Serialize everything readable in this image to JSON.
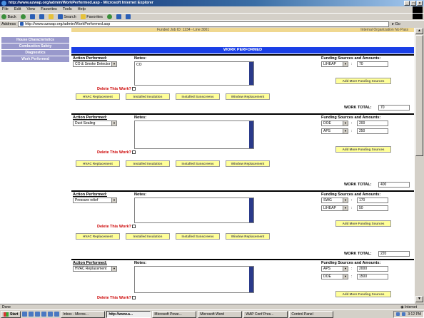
{
  "browser": {
    "title": "http://www.azwap.org/admin/WorkPerformed.asp - Microsoft Internet Explorer",
    "menu": [
      "File",
      "Edit",
      "View",
      "Favorites",
      "Tools",
      "Help"
    ],
    "toolbar": {
      "back": "Back",
      "search": "Search",
      "favorites": "Favorites"
    },
    "address_label": "Address",
    "address": "http://www.azwap.org/admin/WorkPerformed.asp",
    "go": "Go"
  },
  "sidebar": {
    "items": [
      {
        "label": "House Characteristics"
      },
      {
        "label": "Combustion Safety"
      },
      {
        "label": "Diagnostics"
      },
      {
        "label": "Work Performed"
      }
    ]
  },
  "header_strip": {
    "left": "Funded Job ID: 1234 - Line 3001",
    "right": "Internal Organization No Pass"
  },
  "banner": "WORK PERFORMED",
  "labels": {
    "action": "Action Performed:",
    "notes": "Notes:",
    "funding": "Funding Sources and Amounts:",
    "delete": "Delete This Work?",
    "add_funding": "Add More Funding Sources",
    "work_total": "WORK TOTAL:",
    "quick_buttons": [
      "HVAC Replacement",
      "Installed Insulation",
      "Installed Sunscreens",
      "Window Replacement"
    ]
  },
  "work_items": [
    {
      "action": "CO & Smoke Detector",
      "notes": "CO",
      "funding": [
        {
          "source": "LIHEAP",
          "amount": "70"
        }
      ],
      "total": "70"
    },
    {
      "action": "Duct Sealing",
      "notes": "",
      "funding": [
        {
          "source": "DOE",
          "amount": "200"
        },
        {
          "source": "APS",
          "amount": "250"
        }
      ],
      "total": "400"
    },
    {
      "action": "Pressure relief",
      "notes": "",
      "funding": [
        {
          "source": "SWG",
          "amount": "170"
        },
        {
          "source": "LIHEAP",
          "amount": "50"
        }
      ],
      "total": "220"
    },
    {
      "action": "HVAC Replacement",
      "notes": "",
      "funding": [
        {
          "source": "APS",
          "amount": "2000"
        },
        {
          "source": "DOE",
          "amount": "1500"
        }
      ],
      "total": ""
    }
  ],
  "status": {
    "text": "Done",
    "zone": "Internet"
  },
  "taskbar": {
    "start": "Start",
    "buttons": [
      {
        "label": "Inbox - Micros..."
      },
      {
        "label": "http://www.a..."
      },
      {
        "label": "Microsoft Powe..."
      },
      {
        "label": "Microsoft Word"
      },
      {
        "label": "WAP Conf Pres..."
      },
      {
        "label": "Control Panel"
      }
    ],
    "clock": "3:12 PM"
  }
}
